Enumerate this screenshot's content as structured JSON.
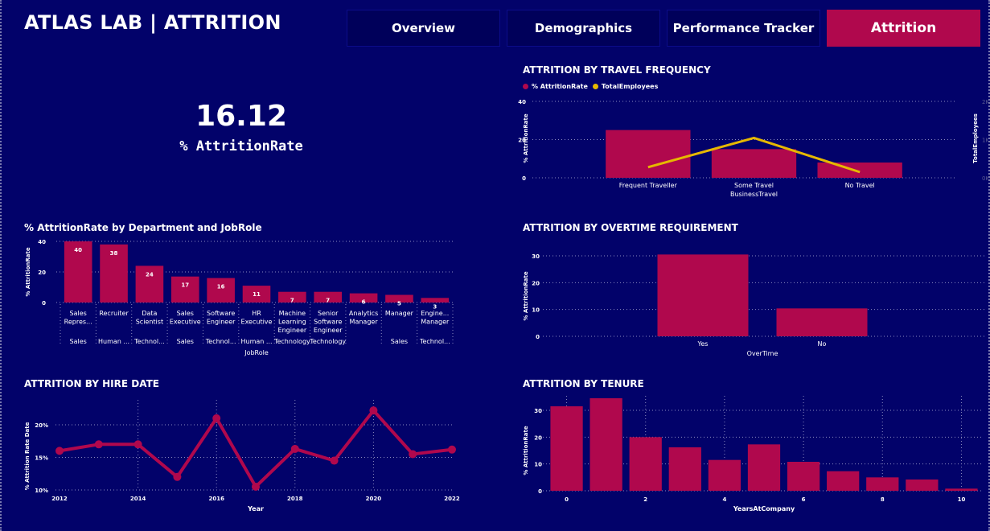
{
  "header": {
    "title": "ATLAS LAB | ATTRITION",
    "tabs": [
      {
        "label": "Overview",
        "active": false
      },
      {
        "label": "Demographics",
        "active": false
      },
      {
        "label": "Performance Tracker",
        "active": false
      },
      {
        "label": "Attrition",
        "active": true
      }
    ]
  },
  "kpi": {
    "value": "16.12",
    "label": "% AttritionRate"
  },
  "colors": {
    "background": "#02026a",
    "bar": "#b0084d",
    "line": "#e6b800",
    "accent": "#b0084d"
  },
  "chart_data": [
    {
      "id": "travel",
      "type": "bar",
      "title": "ATTRITION BY TRAVEL FREQUENCY",
      "legend": [
        {
          "label": "% AttritionRate",
          "color": "#b0084d"
        },
        {
          "label": "TotalEmployees",
          "color": "#e6b800"
        }
      ],
      "legend_position": "top-left",
      "categories": [
        "Frequent Traveller",
        "Some Travel",
        "No Travel"
      ],
      "series": [
        {
          "name": "% AttritionRate",
          "type": "bar",
          "axis": "left",
          "values": [
            25,
            15,
            8
          ]
        },
        {
          "name": "TotalEmployees",
          "type": "line",
          "axis": "right",
          "values": [
            277,
            1043,
            150
          ]
        }
      ],
      "xlabel": "BusinessTravel",
      "ylabel": "% AttritionRate",
      "y2label": "TotalEmployees",
      "ylim": [
        0,
        40
      ],
      "yticks": [
        "0",
        "20",
        "40"
      ],
      "y2lim": [
        0,
        2000
      ],
      "y2ticks": [
        "0K",
        "1K",
        "2K"
      ],
      "grid": true
    },
    {
      "id": "dept",
      "type": "bar",
      "title": "% AttritionRate by Department and JobRole",
      "categories": [
        {
          "role": "Sales Repres...",
          "dept": "Sales"
        },
        {
          "role": "Recruiter",
          "dept": "Human ..."
        },
        {
          "role": "Data Scientist",
          "dept": "Technol..."
        },
        {
          "role": "Sales Executive",
          "dept": "Sales"
        },
        {
          "role": "Software Engineer",
          "dept": "Technol..."
        },
        {
          "role": "HR Executive",
          "dept": "Human ..."
        },
        {
          "role": "Machine Learning Engineer",
          "dept": "Technology"
        },
        {
          "role": "Senior Software Engineer",
          "dept": "Technology"
        },
        {
          "role": "Analytics Manager",
          "dept": ""
        },
        {
          "role": "Manager",
          "dept": "Sales"
        },
        {
          "role": "Engine... Manager",
          "dept": "Technol..."
        }
      ],
      "values": [
        40,
        38,
        24,
        17,
        16,
        11,
        7,
        7,
        6,
        5,
        3
      ],
      "data_labels": [
        "40",
        "38",
        "24",
        "17",
        "16",
        "11",
        "7",
        "7",
        "6",
        "5",
        "3"
      ],
      "xlabel": "JobRole",
      "ylabel": "% AttritionRate",
      "ylim": [
        0,
        40
      ],
      "yticks": [
        "0",
        "20",
        "40"
      ],
      "grid": true
    },
    {
      "id": "overtime",
      "type": "bar",
      "title": "ATTRITION BY OVERTIME REQUIREMENT",
      "categories": [
        "Yes",
        "No"
      ],
      "values": [
        30.5,
        10.4
      ],
      "xlabel": "OverTime",
      "ylabel": "% AttritionRate",
      "ylim": [
        0,
        30
      ],
      "yticks": [
        "0",
        "10",
        "20",
        "30"
      ],
      "grid": true
    },
    {
      "id": "hire",
      "type": "line",
      "title": "ATTRITION BY HIRE DATE",
      "x": [
        2012,
        2013,
        2014,
        2015,
        2016,
        2017,
        2018,
        2019,
        2020,
        2021,
        2022
      ],
      "values": [
        16.0,
        17.0,
        17.0,
        12.0,
        21.0,
        10.5,
        16.3,
        14.5,
        22.2,
        15.5,
        16.2
      ],
      "xticks": [
        "2012",
        "2014",
        "2016",
        "2018",
        "2020",
        "2022"
      ],
      "xlabel": "Year",
      "ylabel": "% Attrition Rate Date",
      "ylim": [
        10,
        20
      ],
      "yticks": [
        "10%",
        "15%",
        "20%"
      ],
      "grid": true
    },
    {
      "id": "tenure",
      "type": "bar",
      "title": "ATTRITION BY TENURE",
      "x": [
        0,
        1,
        2,
        3,
        4,
        5,
        6,
        7,
        8,
        9,
        10
      ],
      "values": [
        31.5,
        34.5,
        20,
        16.2,
        11.5,
        17.3,
        10.8,
        7.3,
        5,
        4.2,
        0.8
      ],
      "xticks": [
        "0",
        "2",
        "4",
        "6",
        "8",
        "10"
      ],
      "xlabel": "YearsAtCompany",
      "ylabel": "% AttritionRate",
      "ylim": [
        0,
        30
      ],
      "yticks": [
        "0",
        "10",
        "20",
        "30"
      ],
      "grid": true
    }
  ]
}
